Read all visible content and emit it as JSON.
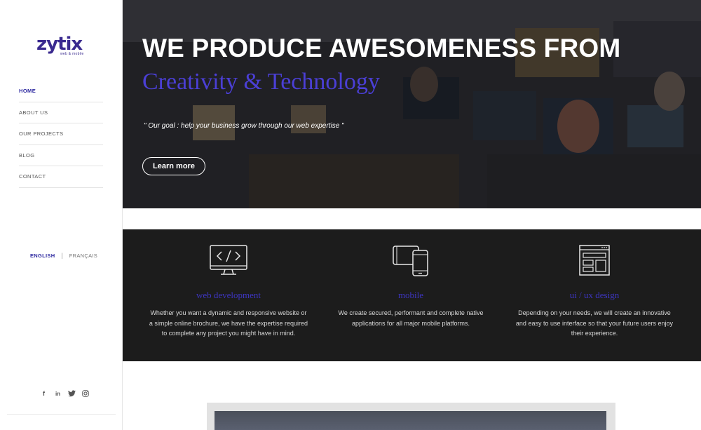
{
  "brand": {
    "name": "zytix",
    "tagline": "web & mobile",
    "color": "#3a2a8f"
  },
  "nav": {
    "items": [
      {
        "label": "HOME",
        "active": true
      },
      {
        "label": "ABOUT US",
        "active": false
      },
      {
        "label": "OUR PROJECTS",
        "active": false
      },
      {
        "label": "BLOG",
        "active": false
      },
      {
        "label": "CONTACT",
        "active": false
      }
    ]
  },
  "language": {
    "english": "ENGLISH",
    "separator": "|",
    "french": "FRANÇAIS",
    "selected": "ENGLISH"
  },
  "social": [
    {
      "icon": "facebook-icon",
      "glyph": "f"
    },
    {
      "icon": "linkedin-icon",
      "glyph": "in"
    },
    {
      "icon": "twitter-icon",
      "glyph": "t"
    },
    {
      "icon": "instagram-icon",
      "glyph": "◎"
    }
  ],
  "hero": {
    "title": "WE PRODUCE AWESOMENESS FROM",
    "subtitle": "Creativity & Technology",
    "quote": "\" Our goal : help your business grow through our web expertise \"",
    "button": "Learn more",
    "accent": "#4b3fd6"
  },
  "services": [
    {
      "icon": "code-monitor-icon",
      "title": "web development",
      "description": "Whether you want a dynamic and responsive website or a simple online brochure, we have the expertise required to complete any project you might have in mind."
    },
    {
      "icon": "mobile-devices-icon",
      "title": "mobile",
      "description": "We create secured, performant and complete native applications for all major mobile platforms."
    },
    {
      "icon": "ui-layout-icon",
      "title": "ui / ux design",
      "description": "Depending on your needs, we will create an innovative and easy to use interface so that your future users enjoy their experience."
    }
  ],
  "colors": {
    "services_bg": "#1c1c1c",
    "service_title": "#3d35c0",
    "nav_active": "#2e2aa0"
  }
}
